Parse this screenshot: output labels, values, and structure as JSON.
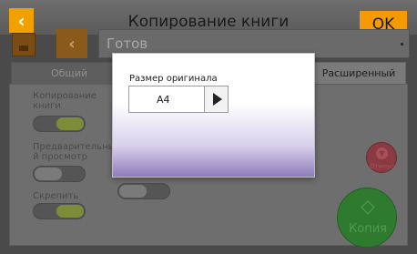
{
  "header": {
    "title": "Копирование книги",
    "back_icon": "chevron-left-icon",
    "ok_label": "OK"
  },
  "status": {
    "text": "Готов",
    "home_icon": "home-icon"
  },
  "tabs": [
    {
      "label": "Общий"
    },
    {
      "label": "Расширенный"
    }
  ],
  "options": {
    "book_copy": {
      "label_line1": "Копирование",
      "label_line2": "книги"
    },
    "preview": {
      "label_line1": "Предварительны",
      "label_line2": "й просмотр"
    },
    "staple": {
      "label": "Скрепить"
    }
  },
  "actions": {
    "stop_label": "Отмена",
    "copy_label": "Копия"
  },
  "dialog": {
    "label": "Размер оригинала",
    "value": "A4"
  },
  "colors": {
    "accent": "#f59a00",
    "copy": "#2e7a2e",
    "stop": "#8a3a42"
  }
}
